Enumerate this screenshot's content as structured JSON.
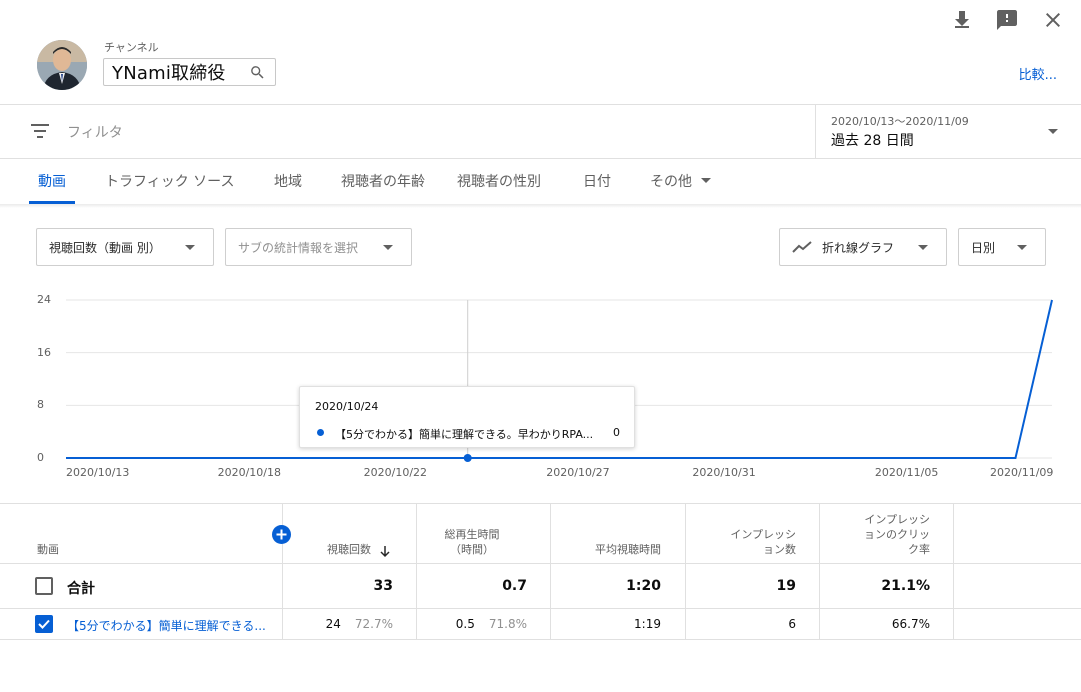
{
  "header": {
    "channel_caption": "チャンネル",
    "channel_name": "YNami取締役",
    "compare_link": "比較..."
  },
  "top_actions": [
    "download-icon",
    "feedback-icon",
    "close-icon"
  ],
  "filter": {
    "placeholder": "フィルタ",
    "date_range_label": "2020/10/13〜2020/11/09",
    "date_range_value": "過去 28 日間"
  },
  "tabs": [
    {
      "label": "動画",
      "active": true
    },
    {
      "label": "トラフィック ソース",
      "active": false
    },
    {
      "label": "地域",
      "active": false
    },
    {
      "label": "視聴者の年齢",
      "active": false
    },
    {
      "label": "視聴者の性別",
      "active": false
    },
    {
      "label": "日付",
      "active": false
    },
    {
      "label": "その他",
      "active": false
    }
  ],
  "controls": {
    "metric_select": "視聴回数（動画 別）",
    "secondary_select": "サブの統計情報を選択",
    "chart_type_select": "折れ線グラフ",
    "interval_select": "日別"
  },
  "colors": {
    "accent": "#065fd4",
    "grid": "#e6e6e6"
  },
  "chart_data": {
    "type": "line",
    "x_ticks": [
      "2020/10/13",
      "2020/10/18",
      "2020/10/22",
      "2020/10/27",
      "2020/10/31",
      "2020/11/05",
      "2020/11/09"
    ],
    "y_ticks": [
      "0",
      "8",
      "16",
      "24"
    ],
    "ylim": [
      0,
      24
    ],
    "grid": true,
    "series": [
      {
        "name": "【5分でわかる】簡単に理解できる。早わかりRPA...",
        "x": [
          "2020/10/13",
          "2020/10/14",
          "2020/10/15",
          "2020/10/16",
          "2020/10/17",
          "2020/10/18",
          "2020/10/19",
          "2020/10/20",
          "2020/10/21",
          "2020/10/22",
          "2020/10/23",
          "2020/10/24",
          "2020/10/25",
          "2020/10/26",
          "2020/10/27",
          "2020/10/28",
          "2020/10/29",
          "2020/10/30",
          "2020/10/31",
          "2020/11/01",
          "2020/11/02",
          "2020/11/03",
          "2020/11/04",
          "2020/11/05",
          "2020/11/06",
          "2020/11/07",
          "2020/11/08",
          "2020/11/09"
        ],
        "values": [
          0,
          0,
          0,
          0,
          0,
          0,
          0,
          0,
          0,
          0,
          0,
          0,
          0,
          0,
          0,
          0,
          0,
          0,
          0,
          0,
          0,
          0,
          0,
          0,
          0,
          0,
          0,
          24
        ]
      }
    ],
    "tooltip": {
      "date": "2020/10/24",
      "title": "【5分でわかる】簡単に理解できる。早わかりRPA...",
      "value": "0"
    }
  },
  "table": {
    "headers": {
      "video": "動画",
      "views": "視聴回数",
      "watch_time_l1": "総再生時間",
      "watch_time_l2": "（時間）",
      "avg_view": "平均視聴時間",
      "impressions_l1": "インプレッシ",
      "impressions_l2": "ョン数",
      "ctr_l1": "インプレッシ",
      "ctr_l2": "ョンのクリッ",
      "ctr_l3": "ク率"
    },
    "total": {
      "label": "合計",
      "views": "33",
      "watch_time": "0.7",
      "avg_view": "1:20",
      "impressions": "19",
      "ctr": "21.1%"
    },
    "rows": [
      {
        "title": "【5分でわかる】簡単に理解できる...",
        "views": "24",
        "views_pct": "72.7%",
        "watch_time": "0.5",
        "watch_time_pct": "71.8%",
        "avg_view": "1:19",
        "impressions": "6",
        "ctr": "66.7%",
        "checked": true
      }
    ]
  }
}
